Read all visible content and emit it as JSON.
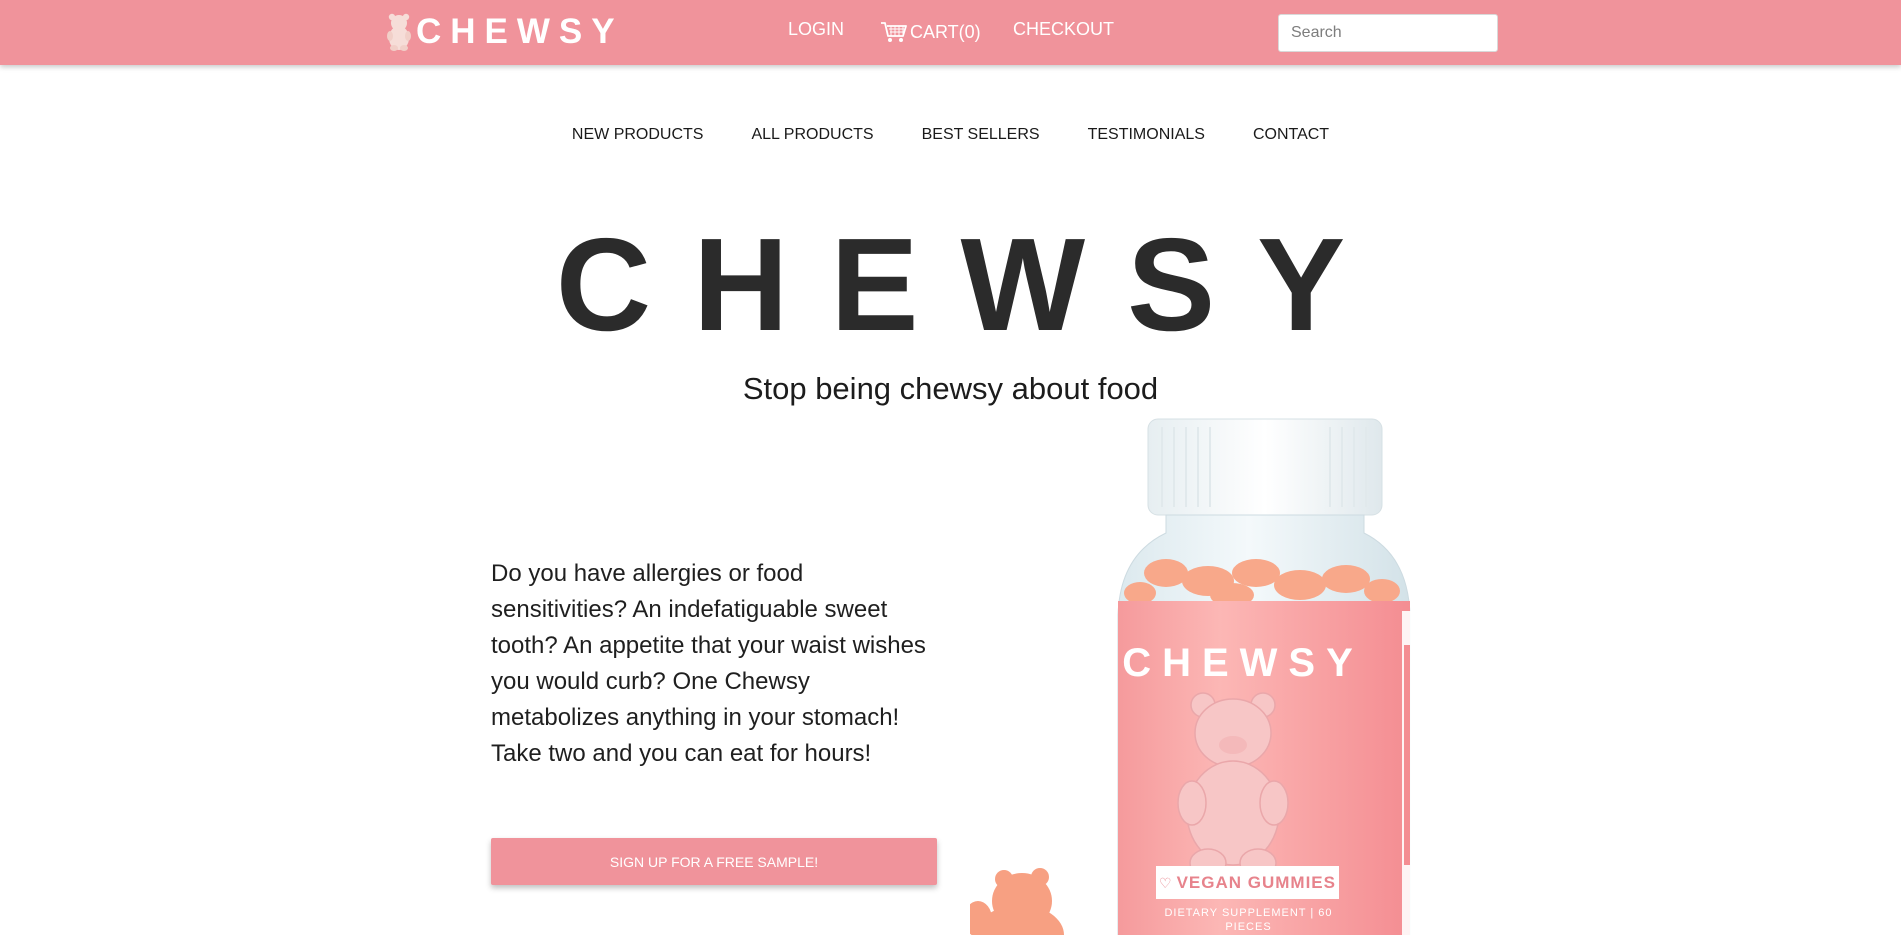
{
  "header": {
    "logo_text": "CHEWSY",
    "nav": {
      "login": "LOGIN",
      "cart": "CART(0)",
      "checkout": "CHECKOUT"
    },
    "search": {
      "placeholder": "Search",
      "value": ""
    }
  },
  "categories": [
    "NEW PRODUCTS",
    "ALL PRODUCTS",
    "BEST SELLERS",
    "TESTIMONIALS",
    "CONTACT"
  ],
  "hero": {
    "title": "CHEWSY",
    "subtitle": "Stop being chewsy about food",
    "blurb": "Do you have allergies or food sensitivities? An indefatiguable sweet tooth? An appetite that your waist wishes you would curb? One Chewsy metabolizes anything in your stomach! Take two and you can eat for hours!",
    "cta": "SIGN UP FOR A FREE SAMPLE!"
  },
  "product": {
    "label_brand": "CHEWSY",
    "badge": "VEGAN GUMMIES",
    "fine_print": "DIETARY SUPPLEMENT | 60 PIECES"
  },
  "colors": {
    "brand_pink": "#f0939b",
    "text_dark": "#2b2b2b",
    "gummy_orange": "#f6a080"
  },
  "icons": [
    "bear-logo-icon",
    "cart-icon"
  ]
}
